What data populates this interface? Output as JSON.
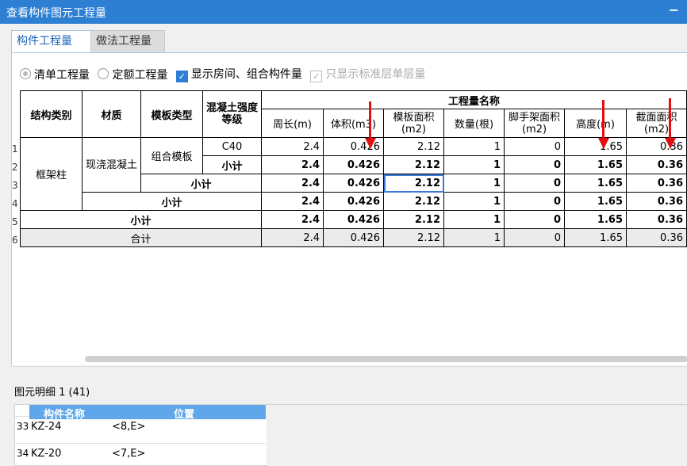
{
  "window": {
    "title": "查看构件图元工程量",
    "minimize": "−"
  },
  "tabs": [
    {
      "label": "构件工程量",
      "active": true
    },
    {
      "label": "做法工程量",
      "active": false
    }
  ],
  "options": {
    "radio_list": "清单工程量",
    "radio_quota": "定额工程量",
    "check_rooms": "显示房间、组合构件量",
    "check_std": "只显示标准层单层量"
  },
  "table": {
    "headers": {
      "struct": "结构类别",
      "material": "材质",
      "formwork": "模板类型",
      "concrete": "混凝土强度等级",
      "group": "工程量名称",
      "cols": [
        "周长(m)",
        "体积(m3)",
        "模板面积(m2)",
        "数量(根)",
        "脚手架面积(m2)",
        "高度(m)",
        "截面面积(m2)"
      ]
    },
    "row_numbers": [
      "1",
      "2",
      "3",
      "4",
      "5",
      "6"
    ],
    "struct_label": "框架柱",
    "material_label": "现浇混凝土",
    "formwork_label": "组合模板",
    "concrete_label": "C40",
    "subtotal": "小计",
    "total": "合计",
    "rows": [
      [
        "2.4",
        "0.426",
        "2.12",
        "1",
        "0",
        "1.65",
        "0.36"
      ],
      [
        "2.4",
        "0.426",
        "2.12",
        "1",
        "0",
        "1.65",
        "0.36"
      ],
      [
        "2.4",
        "0.426",
        "2.12",
        "1",
        "0",
        "1.65",
        "0.36"
      ],
      [
        "2.4",
        "0.426",
        "2.12",
        "1",
        "0",
        "1.65",
        "0.36"
      ],
      [
        "2.4",
        "0.426",
        "2.12",
        "1",
        "0",
        "1.65",
        "0.36"
      ],
      [
        "2.4",
        "0.426",
        "2.12",
        "1",
        "0",
        "1.65",
        "0.36"
      ]
    ]
  },
  "detail": {
    "title": "图元明细  1 (41)",
    "headers": {
      "name": "构件名称",
      "position": "位置"
    },
    "rows": [
      {
        "num": "33",
        "name": "KZ-24",
        "position": "<8,E>"
      },
      {
        "num": "34",
        "name": "KZ-20",
        "position": "<7,E>"
      }
    ]
  },
  "colors": {
    "title_bar": "#2d7fd3",
    "accent": "#2d7fd3",
    "arrow": "#e01010"
  }
}
